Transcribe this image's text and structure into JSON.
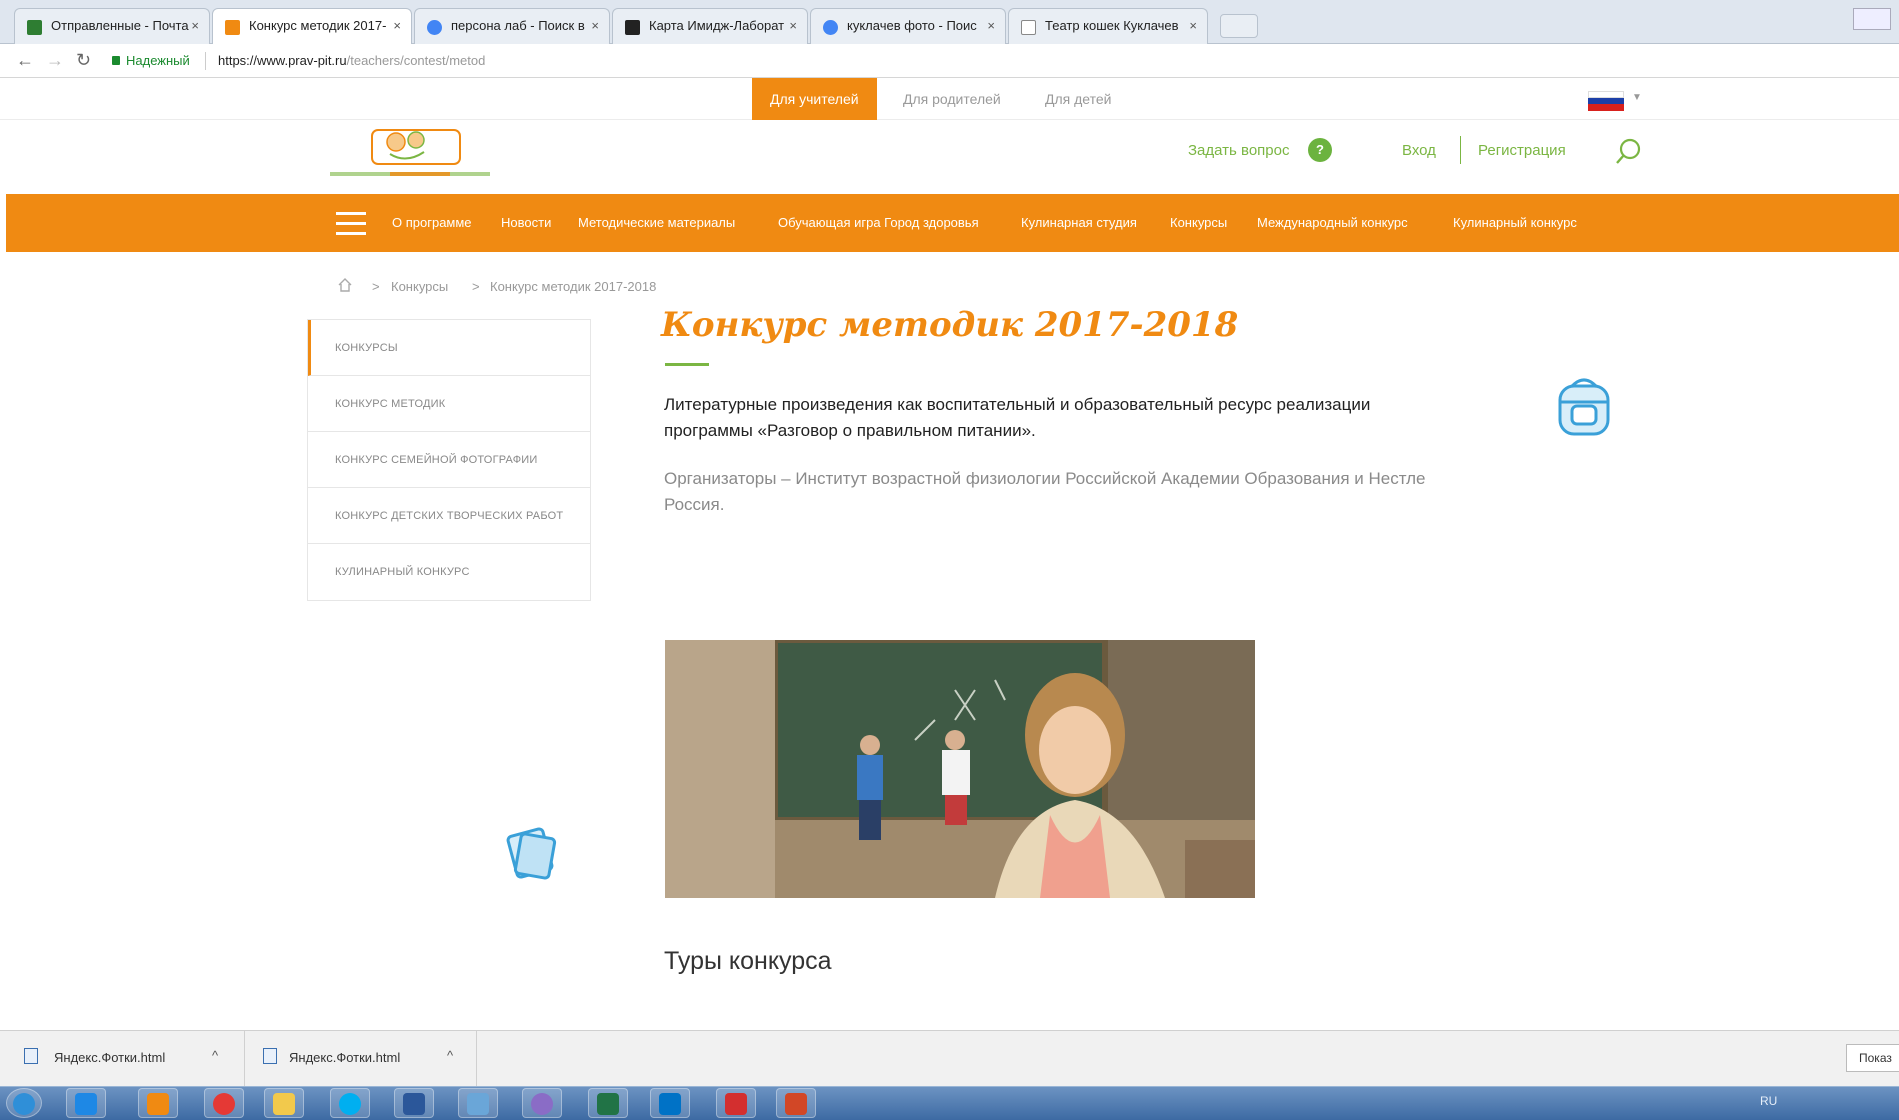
{
  "browser": {
    "tabs": [
      {
        "label": "Отправленные - Почта",
        "color": "#2e7d32"
      },
      {
        "label": "Конкурс методик 2017-",
        "color": "#f08a12"
      },
      {
        "label": "персона лаб - Поиск в",
        "color": "#4285f4"
      },
      {
        "label": "Карта Имидж-Лаборат",
        "color": "#222222"
      },
      {
        "label": "куклачев фото - Поис",
        "color": "#4285f4"
      },
      {
        "label": "Театр кошек Куклачев",
        "color": "#888888"
      }
    ],
    "close_glyph": "×",
    "secure_label": "Надежный",
    "url_host": "https://www.prav-pit.ru",
    "url_path": "/teachers/contest/metod"
  },
  "audience": {
    "teachers": "Для учителей",
    "parents": "Для родителей",
    "children": "Для детей"
  },
  "header": {
    "ask_question": "Задать вопрос",
    "ask_badge": "?",
    "login": "Вход",
    "register": "Регистрация"
  },
  "nav": {
    "items": [
      "О программе",
      "Новости",
      "Методические материалы",
      "Обучающая игра Город здоровья",
      "Кулинарная студия",
      "Конкурсы",
      "Международный конкурс",
      "Кулинарный конкурс"
    ]
  },
  "breadcrumb": {
    "sep": ">",
    "level1": "Конкурсы",
    "level2": "Конкурс методик 2017-2018"
  },
  "sidebar": {
    "items": [
      "Конкурсы",
      "Конкурс методик",
      "Конкурс семейной фотографии",
      "Конкурс детских творческих работ",
      "Кулинарный конкурс"
    ]
  },
  "content": {
    "title": "Конкурс методик 2017-2018",
    "lead": "Литературные произведения как воспитательный и образовательный ресурс реализации программы «Разговор о правильном питании».",
    "organizers": "Организаторы – Институт возрастной физиологии Российской Академии Образования и Нестле Россия.",
    "section_title": "Туры конкурса"
  },
  "downloads": {
    "items": [
      "Яндекс.Фотки.html",
      "Яндекс.Фотки.html"
    ],
    "caret": "^",
    "show_all": "Показ"
  },
  "taskbar": {
    "tray_text": "RU"
  },
  "colors": {
    "brand_orange": "#f08a12",
    "brand_green": "#7bb643"
  }
}
